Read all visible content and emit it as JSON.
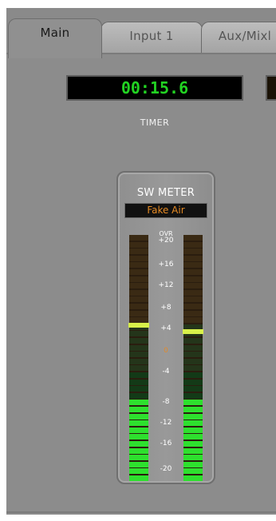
{
  "tabs": [
    {
      "label": "Main",
      "active": true
    },
    {
      "label": "Input 1",
      "active": false
    },
    {
      "label": "Aux/Mixl",
      "active": false
    }
  ],
  "timer": {
    "value": "00:15.6",
    "label": "TIMER"
  },
  "meter": {
    "title": "SW METER",
    "source": "Fake Air",
    "scale": [
      "OVR",
      "+20",
      "+16",
      "+12",
      "+8",
      "+4",
      "0",
      "-4",
      "-8",
      "-12",
      "-16",
      "-20"
    ],
    "left_peak": "+5",
    "right_peak": "+4",
    "left_level": "-7",
    "right_level": "-7"
  },
  "colors": {
    "panel": "#8c8c8c",
    "timer_text": "#22d322",
    "source_text": "#e58a24",
    "meter_green": "#2ee02e",
    "peak": "#d8f04a"
  }
}
